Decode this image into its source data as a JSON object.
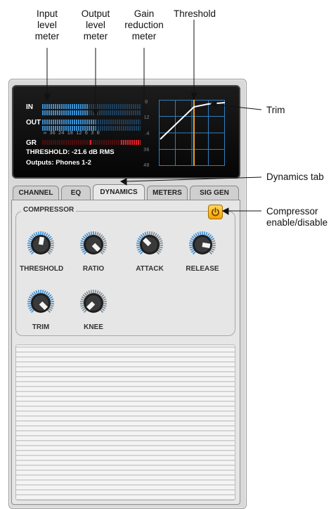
{
  "callouts": {
    "input_meter": [
      "Input",
      "level",
      "meter"
    ],
    "output_meter": [
      "Output",
      "level",
      "meter"
    ],
    "gain_reduction": [
      "Gain",
      "reduction",
      "meter"
    ],
    "threshold": "Threshold",
    "trim": "Trim",
    "dynamics_tab": "Dynamics tab",
    "compressor_enable": [
      "Compressor",
      "enable/disable"
    ]
  },
  "display": {
    "in_label": "IN",
    "out_label": "OUT",
    "gr_label": "GR",
    "scale": "∞ 36 24 18  12   6   3   0",
    "threshold_text": "THRESHOLD: -21.6 dB RMS",
    "outputs_text": "Outputs: Phones 1-2",
    "graph_ticks": [
      "0",
      "12",
      "24",
      "36",
      "48"
    ],
    "in_level": 0.46,
    "out_level": 0.53,
    "gr_level": 0.2
  },
  "tabs": [
    {
      "label": "CHANNEL"
    },
    {
      "label": "EQ"
    },
    {
      "label": "DYNAMICS",
      "active": true
    },
    {
      "label": "METERS"
    },
    {
      "label": "SIG GEN"
    }
  ],
  "compressor": {
    "title": "COMPRESSOR",
    "power_on": true,
    "knobs": [
      {
        "label": "THRESHOLD"
      },
      {
        "label": "RATIO"
      },
      {
        "label": "ATTACK"
      },
      {
        "label": "RELEASE"
      },
      {
        "label": "TRIM"
      },
      {
        "label": "KNEE"
      }
    ]
  },
  "colors": {
    "meter_blue": "#3d8fd0",
    "meter_red": "#d8242a",
    "threshold_line": "#f0a020",
    "power_button": "#f5b800",
    "graph_grid": "#2f7fc0"
  }
}
